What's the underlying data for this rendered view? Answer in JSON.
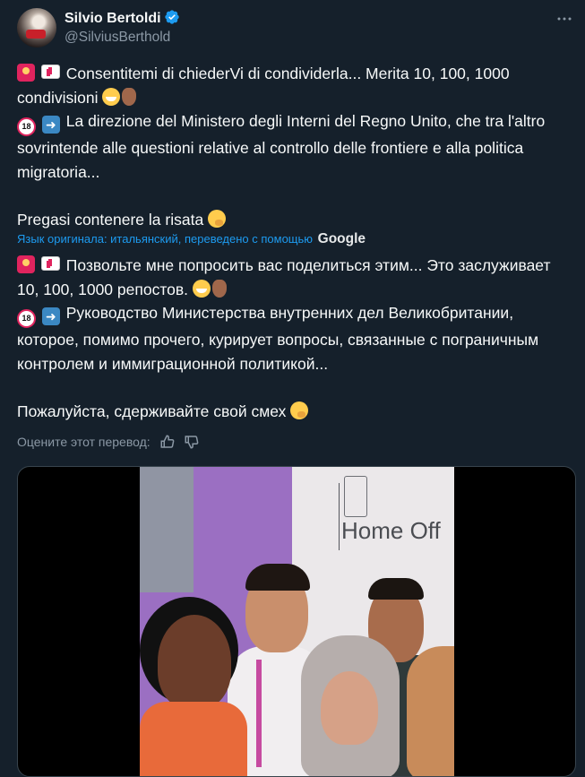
{
  "author": {
    "name": "Silvio Bertoldi",
    "handle": "@SilviusBerthold",
    "verified": true
  },
  "original": {
    "line1": "Consentitemi di chiederVi di condividerla... Merita 10, 100, 1000 condivisioni",
    "line2": "La direzione del Ministero degli Interni del Regno Unito, che tra l'altro sovrintende alle questioni relative al controllo delle frontiere e alla politica migratoria...",
    "line3": "Pregasi contenere la risata"
  },
  "translation": {
    "label": "Язык оригинала: итальянский, переведено с помощью",
    "provider": "Google",
    "line1": "Позвольте мне попросить вас поделиться этим... Это заслуживает 10, 100, 1000 репостов.",
    "line2": "Руководство Министерства внутренних дел Великобритании, которое, помимо прочего, курирует вопросы, связанные с пограничным контролем и иммиграционной политикой...",
    "line3": "Пожалуйста, сдерживайте свой смех"
  },
  "rate": {
    "label": "Оцените этот перевод:"
  },
  "media": {
    "sign_text": "Home Off"
  },
  "icons": [
    "verified-badge-icon",
    "more-icon",
    "siren-emoji",
    "ambulance-emoji",
    "no-under-18-emoji",
    "right-arrow-emoji",
    "grinning-emoji",
    "pointing-down-hand-emoji",
    "giggle-emoji",
    "thumbs-up-icon",
    "thumbs-down-icon"
  ],
  "colors": {
    "background": "#15202b",
    "accent": "#1d9bf0",
    "secondary_text": "#8b98a5"
  }
}
